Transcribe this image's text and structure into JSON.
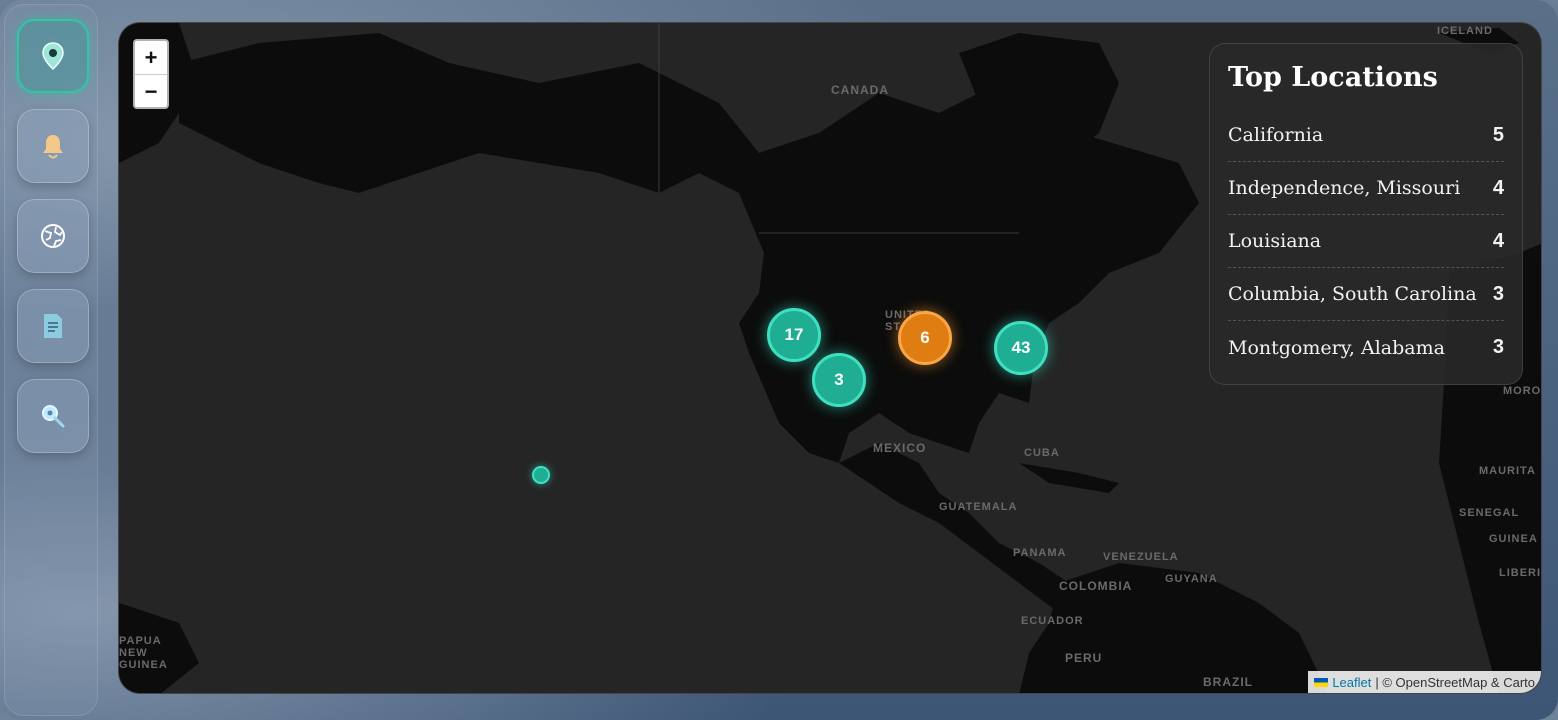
{
  "nav": {
    "items": [
      {
        "name": "map-pin-icon",
        "active": true
      },
      {
        "name": "bell-icon",
        "active": false
      },
      {
        "name": "globe-icon",
        "active": false
      },
      {
        "name": "document-icon",
        "active": false
      },
      {
        "name": "search-icon",
        "active": false
      }
    ]
  },
  "map": {
    "zoom_in": "+",
    "zoom_out": "−",
    "labels": {
      "canada": "CANADA",
      "united_states": "UNITED STATES",
      "mexico": "MEXICO",
      "cuba": "CUBA",
      "guatemala": "GUATEMALA",
      "panama": "PANAMA",
      "venezuela": "VENEZUELA",
      "colombia": "COLOMBIA",
      "guyana": "GUYANA",
      "ecuador": "ECUADOR",
      "peru": "PERU",
      "brazil": "BRAZIL",
      "iceland": "ICELAND",
      "senegal": "SENEGAL",
      "guinea": "GUINEA",
      "liberia": "LIBERIA",
      "mauritania": "MAURITA",
      "morocco": "MORO",
      "papua": "PAPUA NEW GUINEA"
    },
    "clusters": {
      "west": "17",
      "southwest": "3",
      "central": "6",
      "east": "43"
    },
    "colors": {
      "teal": "#1fae93",
      "orange": "#e07d12"
    },
    "attribution": {
      "leaflet": "Leaflet",
      "rest": "| © OpenStreetMap & Carto"
    }
  },
  "top_locations": {
    "title": "Top Locations",
    "items": [
      {
        "name": "California",
        "count": "5"
      },
      {
        "name": "Independence, Missouri",
        "count": "4"
      },
      {
        "name": "Louisiana",
        "count": "4"
      },
      {
        "name": "Columbia, South Carolina",
        "count": "3"
      },
      {
        "name": "Montgomery, Alabama",
        "count": "3"
      }
    ]
  }
}
